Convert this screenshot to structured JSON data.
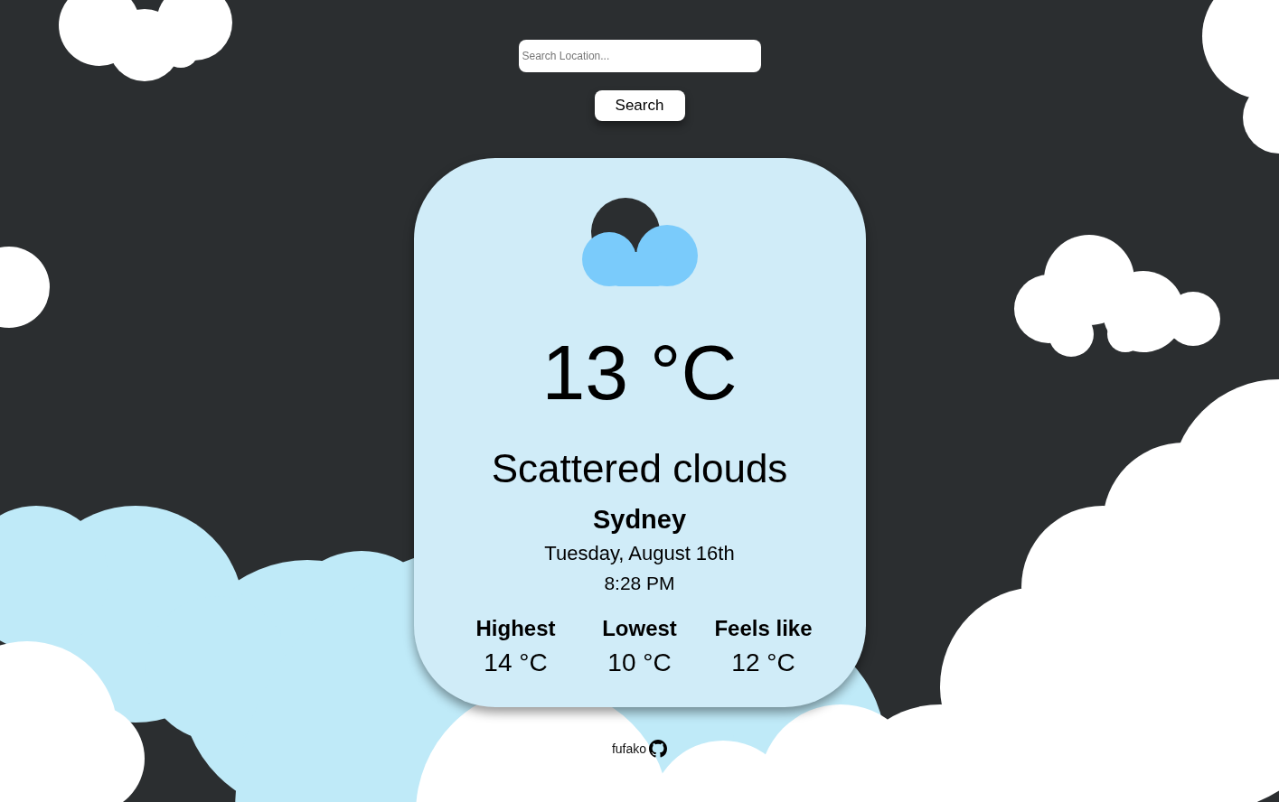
{
  "search": {
    "placeholder": "Search Location...",
    "button": "Search"
  },
  "weather": {
    "temperature": "13 °C",
    "description": "Scattered clouds",
    "city": "Sydney",
    "date": "Tuesday, August 16th",
    "time": "8:28 PM",
    "stats": [
      {
        "label": "Highest",
        "value": "14 °C"
      },
      {
        "label": "Lowest",
        "value": "10 °C"
      },
      {
        "label": "Feels like",
        "value": "12 °C"
      }
    ]
  },
  "footer": {
    "author": "fufako"
  }
}
